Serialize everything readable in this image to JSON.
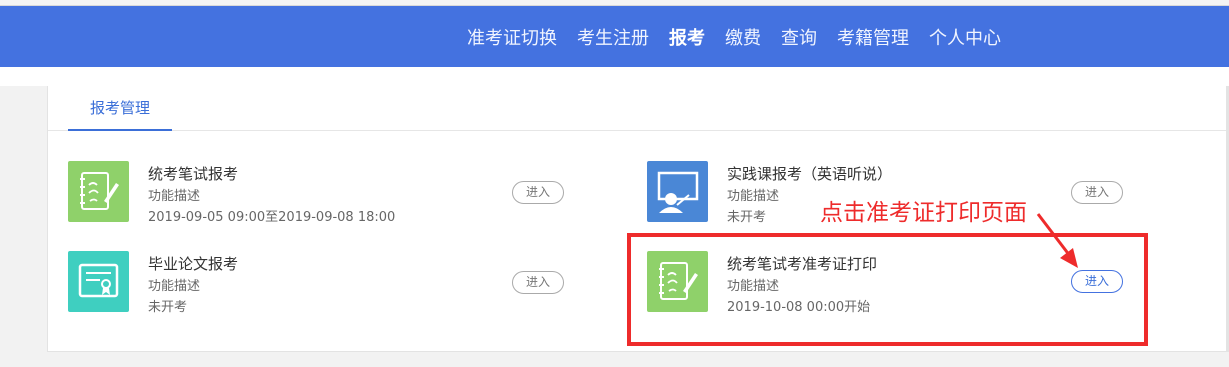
{
  "nav": {
    "items": [
      {
        "label": "准考证切换",
        "active": false
      },
      {
        "label": "考生注册",
        "active": false
      },
      {
        "label": "报考",
        "active": true
      },
      {
        "label": "缴费",
        "active": false
      },
      {
        "label": "查询",
        "active": false
      },
      {
        "label": "考籍管理",
        "active": false
      },
      {
        "label": "个人中心",
        "active": false
      }
    ]
  },
  "tab": {
    "label": "报考管理"
  },
  "cards": [
    {
      "title": "统考笔试报考",
      "desc": "功能描述",
      "meta": "2019-09-05 09:00至2019-09-08 18:00",
      "button": "进入",
      "icon": "notebook-pen-icon"
    },
    {
      "title": "实践课报考（英语听说）",
      "desc": "功能描述",
      "meta": "未开考",
      "button": "进入",
      "icon": "teacher-board-icon"
    },
    {
      "title": "毕业论文报考",
      "desc": "功能描述",
      "meta": "未开考",
      "button": "进入",
      "icon": "certificate-icon"
    },
    {
      "title": "统考笔试考准考证打印",
      "desc": "功能描述",
      "meta": "2019-10-08 00:00开始",
      "button": "进入",
      "icon": "notebook-pen-icon"
    }
  ],
  "annotation": {
    "text": "点击准考证打印页面"
  },
  "colors": {
    "nav_bg": "#4472e0",
    "accent": "#3b6fd8",
    "annotation": "#ee2b2b",
    "green_icon": "#8fd16a",
    "blue_icon": "#4a87d6",
    "teal_icon": "#3fcfc0"
  }
}
